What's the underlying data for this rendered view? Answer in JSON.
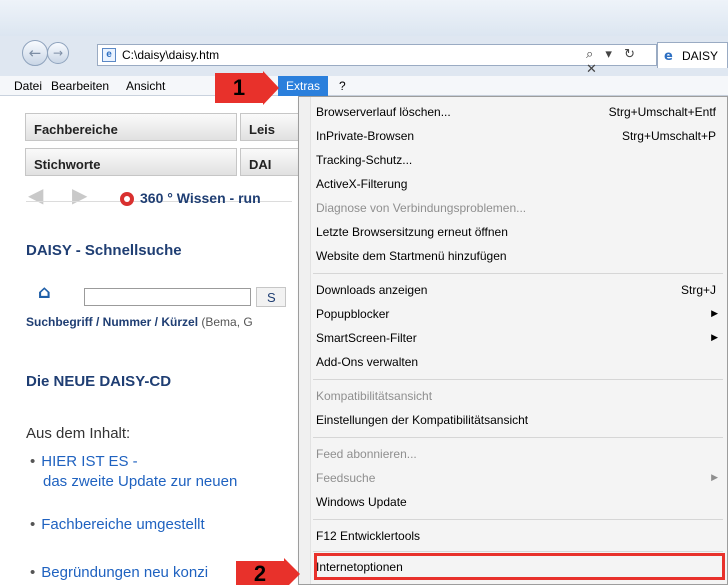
{
  "browser": {
    "address": "C:\\daisy\\daisy.htm",
    "tab_title": "DAISY",
    "address_tools": "⌕ ▾ ↻ ✕",
    "nav_back_icon": "back-arrow-icon",
    "nav_forward_icon": "forward-arrow-icon"
  },
  "menubar": {
    "datei": "Datei",
    "bearbeiten": "Bearbeiten",
    "ansicht": "Ansicht",
    "extras": "Extras",
    "help": "?"
  },
  "page": {
    "buttons": [
      "Fachbereiche",
      "Leis",
      "Stichworte",
      "DAI"
    ],
    "banner": "360 ° Wissen - run",
    "schnellsuche_title": "DAISY - Schnellsuche",
    "search_button": "S",
    "hint_bold": "Suchbegriff / Nummer / Kürzel",
    "hint_light": "(Bema, G",
    "neue_title": "Die NEUE DAISY-CD",
    "aus_dem_inhalt": "Aus dem Inhalt:",
    "links": [
      {
        "line1": "HIER IST ES -",
        "line2": "das zweite Update zur neuen"
      },
      {
        "line1": "Fachbereiche umgestellt"
      },
      {
        "line1": "Begründungen neu konzi"
      }
    ]
  },
  "annotations": {
    "step1": "1",
    "step2": "2",
    "color": "#e8312b"
  },
  "extras_menu": {
    "items": [
      {
        "label": "Browserverlauf löschen...",
        "shortcut": "Strg+Umschalt+Entf",
        "disabled": false
      },
      {
        "label": "InPrivate-Browsen",
        "shortcut": "Strg+Umschalt+P",
        "disabled": false
      },
      {
        "label": "Tracking-Schutz...",
        "shortcut": "",
        "disabled": false
      },
      {
        "label": "ActiveX-Filterung",
        "shortcut": "",
        "disabled": false
      },
      {
        "label": "Diagnose von Verbindungsproblemen...",
        "shortcut": "",
        "disabled": true
      },
      {
        "label": "Letzte Browsersitzung erneut öffnen",
        "shortcut": "",
        "disabled": false
      },
      {
        "label": "Website dem Startmenü hinzufügen",
        "shortcut": "",
        "disabled": false
      },
      {
        "label": "Downloads anzeigen",
        "shortcut": "Strg+J",
        "disabled": false
      },
      {
        "label": "Popupblocker",
        "submenu": "▶",
        "disabled": false
      },
      {
        "label": "SmartScreen-Filter",
        "submenu": "▶",
        "disabled": false
      },
      {
        "label": "Add-Ons verwalten",
        "shortcut": "",
        "disabled": false
      },
      {
        "label": "Kompatibilitätsansicht",
        "shortcut": "",
        "disabled": true
      },
      {
        "label": "Einstellungen der Kompatibilitätsansicht",
        "shortcut": "",
        "disabled": false
      },
      {
        "label": "Feed abonnieren...",
        "shortcut": "",
        "disabled": true
      },
      {
        "label": "Feedsuche",
        "submenu": "▶",
        "disabled": true
      },
      {
        "label": "Windows Update",
        "shortcut": "",
        "disabled": false
      },
      {
        "label": "F12 Entwicklertools",
        "shortcut": "",
        "disabled": false
      },
      {
        "label": "Internetoptionen",
        "shortcut": "",
        "disabled": false
      }
    ]
  }
}
